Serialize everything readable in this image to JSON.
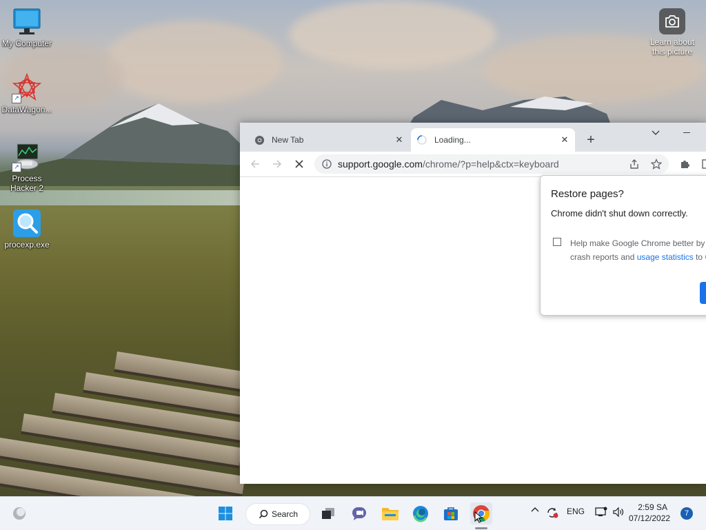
{
  "desktop": {
    "icons": [
      {
        "label": "My Computer"
      },
      {
        "label": "DataWagon..."
      },
      {
        "label": "Process Hacker 2"
      },
      {
        "label": "procexp.exe"
      }
    ],
    "learn_about": "Learn about this picture"
  },
  "browser": {
    "tabs": [
      {
        "label": "New Tab",
        "active": false
      },
      {
        "label": "Loading...",
        "active": true
      }
    ],
    "url_host": "support.google.com",
    "url_path": "/chrome/?p=help&ctx=keyboard",
    "restore_popup": {
      "title": "Restore pages?",
      "message": "Chrome didn't shut down correctly.",
      "checkbox_line1": "Help make Google Chrome better by",
      "checkbox_line2_prefix": "crash reports and ",
      "checkbox_link": "usage statistics",
      "checkbox_line2_suffix": " to C",
      "checked": false
    }
  },
  "taskbar": {
    "search_label": "Search",
    "language": "ENG",
    "time": "2:59 SA",
    "date": "07/12/2022",
    "notification_count": "7"
  },
  "colors": {
    "accent": "#1a73e8",
    "taskbar_bg": "#f0f3f8",
    "tabstrip_bg": "#dee1e6"
  }
}
